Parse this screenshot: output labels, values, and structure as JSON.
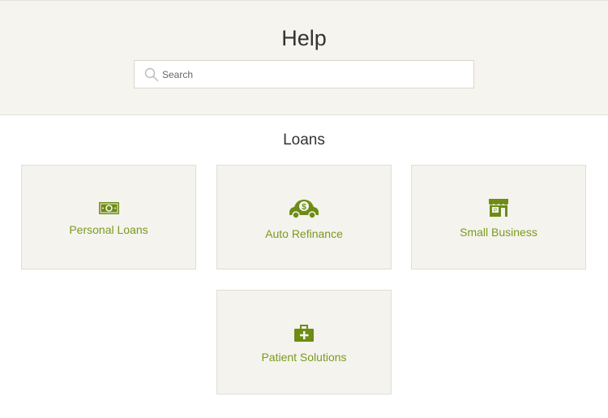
{
  "header": {
    "title": "Help",
    "search": {
      "placeholder": "Search",
      "value": ""
    }
  },
  "section": {
    "title": "Loans"
  },
  "cards": [
    {
      "label": "Personal Loans",
      "icon": "cash-icon"
    },
    {
      "label": "Auto Refinance",
      "icon": "car-dollar-icon"
    },
    {
      "label": "Small Business",
      "icon": "storefront-icon"
    },
    {
      "label": "Patient Solutions",
      "icon": "medical-kit-icon"
    }
  ],
  "colors": {
    "accent": "#7a9a1f",
    "header_bg": "#f6f4ef",
    "card_bg": "#f5f3ee"
  }
}
